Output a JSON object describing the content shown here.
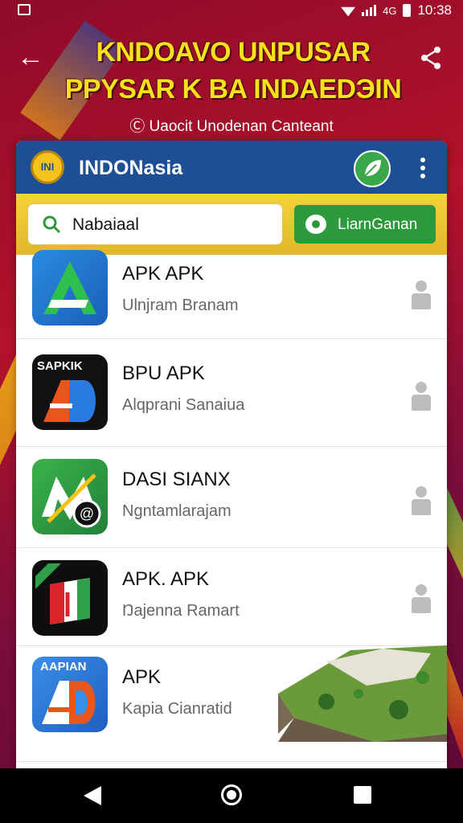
{
  "status_bar": {
    "time": "10:38",
    "network": "4G"
  },
  "header": {
    "title_line1": "KNDOAVO UNPUSAR",
    "title_line2": "PPYSAR K BA INDAEDЭIN",
    "subtitle": "Uaocit Unodenan Canteant"
  },
  "card": {
    "title": "INDONasia",
    "emblem_text": "INI"
  },
  "search": {
    "value": "Nabaiaal"
  },
  "learn_button": {
    "label": "LiarnGanan"
  },
  "apps": [
    {
      "name": "APK APK",
      "desc": "Ulnjram Branam",
      "icon": "app-icon-a-green-blue"
    },
    {
      "name": "BPU APK",
      "desc": "Alqprani Sanaiua",
      "icon": "app-icon-ad-black",
      "icon_text": "SAPKIK"
    },
    {
      "name": "DASI SIANX",
      "desc": "Ngntamlarajam",
      "icon": "app-icon-m-green"
    },
    {
      "name": "APK. APK",
      "desc": "Ŋajenna Ramart",
      "icon": "app-icon-a-flag-black"
    },
    {
      "name": "APK",
      "desc": "Kapia Cianratid",
      "icon": "app-icon-ad-blue",
      "icon_text": "AAPIAN"
    }
  ],
  "colors": {
    "header_blue": "#1e4f95",
    "accent_yellow": "#f4d23c",
    "accent_green": "#2c9a3c",
    "background_red": "#b3122a"
  }
}
